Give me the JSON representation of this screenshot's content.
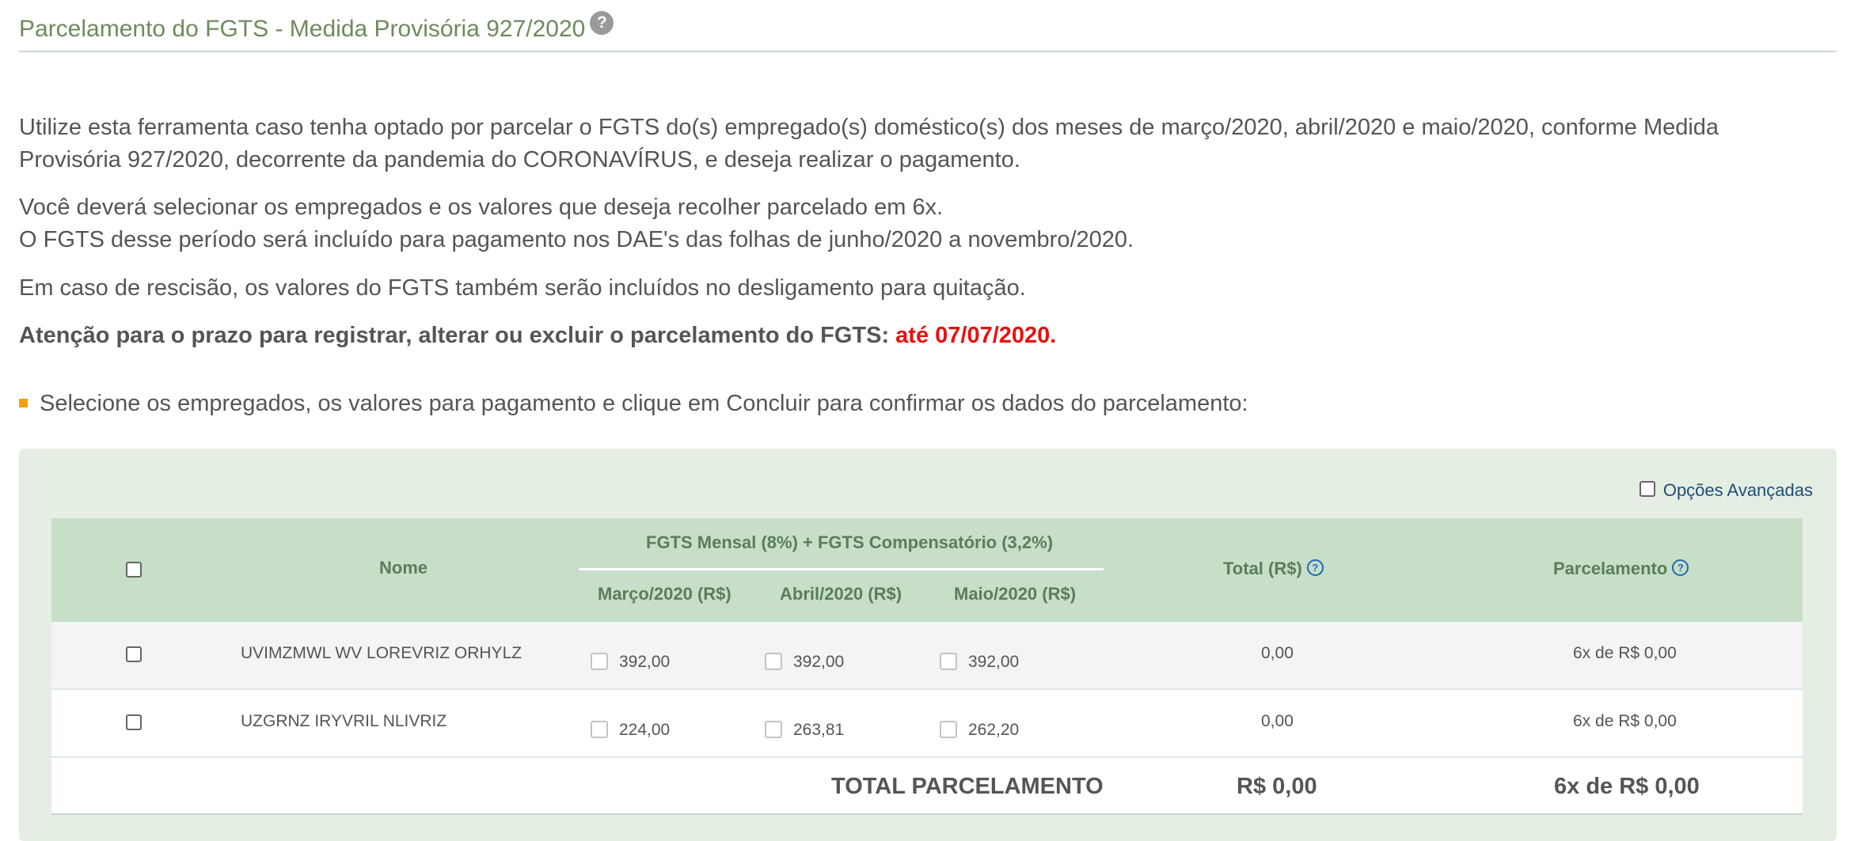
{
  "header": {
    "title": "Parcelamento do FGTS - Medida Provisória 927/2020",
    "help_glyph": "?"
  },
  "intro": {
    "p1_line1": "Utilize esta ferramenta caso tenha optado por parcelar o FGTS do(s) empregado(s) doméstico(s) dos meses de março/2020, abril/2020 e maio/2020, conforme Medida",
    "p1_line2": "Provisória 927/2020, decorrente da pandemia do CORONAVÍRUS, e deseja realizar o pagamento.",
    "p2_line1": "Você deverá selecionar os empregados e os valores que deseja recolher parcelado em 6x.",
    "p2_line2": "O FGTS desse período será incluído para pagamento nos DAE's das folhas de junho/2020 a novembro/2020.",
    "p3": "Em caso de rescisão, os valores do FGTS também serão incluídos no desligamento para quitação.",
    "attention": "Atenção para o prazo para registrar, alterar ou excluir o parcelamento do FGTS:",
    "deadline": "até 07/07/2020."
  },
  "instruction": "Selecione os empregados, os valores para pagamento e clique em Concluir para confirmar os dados do parcelamento:",
  "advanced_options_label": "Opções Avançadas",
  "table": {
    "col_name": "Nome",
    "group_header": "FGTS Mensal (8%) + FGTS Compensatório (3,2%)",
    "col_march": "Março/2020 (R$)",
    "col_april": "Abril/2020 (R$)",
    "col_may": "Maio/2020 (R$)",
    "col_total": "Total (R$)",
    "col_installment": "Parcelamento",
    "help_glyph": "?",
    "rows": [
      {
        "name": "UVIMZMWL WV LOREVRIZ ORHYLZ",
        "march": "392,00",
        "april": "392,00",
        "may": "392,00",
        "total": "0,00",
        "installment": "6x de R$ 0,00"
      },
      {
        "name": "UZGRNZ IRYVRIL NLIVRIZ",
        "march": "224,00",
        "april": "263,81",
        "may": "262,20",
        "total": "0,00",
        "installment": "6x de R$ 0,00"
      }
    ],
    "total_label": "TOTAL PARCELAMENTO",
    "total_value": "R$ 0,00",
    "total_installment": "6x de R$ 0,00"
  },
  "colors": {
    "title_green": "#6f8a5f",
    "header_bg": "#c7dfc8",
    "panel_bg": "#e4eee3",
    "alert_red": "#e8110f",
    "bullet_orange": "#f5a00a",
    "link_blue": "#1f4f7a"
  }
}
